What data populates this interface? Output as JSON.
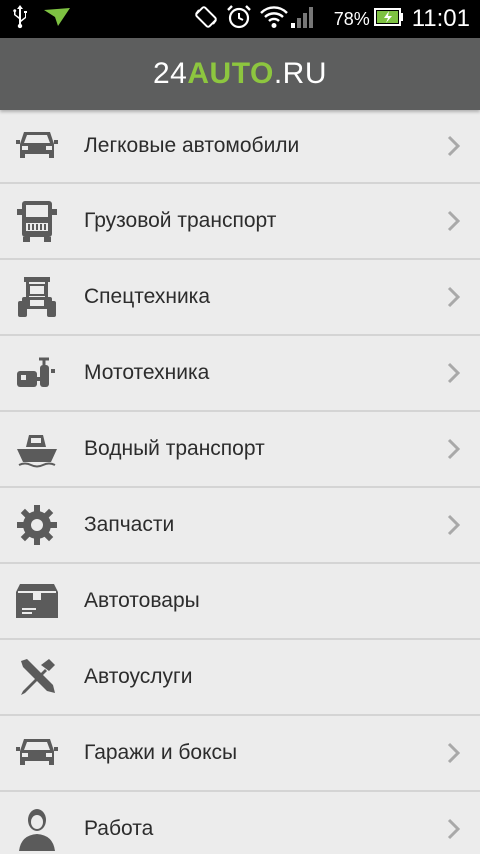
{
  "status_bar": {
    "battery_percent": "78%",
    "time": "11:01",
    "icons": [
      "usb-icon",
      "notification-arrow-icon",
      "rotation-icon",
      "alarm-icon",
      "wifi-icon",
      "signal-icon",
      "battery-charging-icon"
    ]
  },
  "app_bar": {
    "logo_part1": "24",
    "logo_part2": "AUTO",
    "logo_part3": ".RU",
    "accent_color": "#8dc63f",
    "bar_color": "#5d5e5e"
  },
  "menu": {
    "items": [
      {
        "label": "Легковые автомобили",
        "icon": "car-icon",
        "has_chevron": true
      },
      {
        "label": "Грузовой транспорт",
        "icon": "truck-icon",
        "has_chevron": true
      },
      {
        "label": "Спецтехника",
        "icon": "special-vehicle-icon",
        "has_chevron": true
      },
      {
        "label": "Мототехника",
        "icon": "motorcycle-icon",
        "has_chevron": true
      },
      {
        "label": "Водный транспорт",
        "icon": "boat-icon",
        "has_chevron": true
      },
      {
        "label": "Запчасти",
        "icon": "gear-icon",
        "has_chevron": true
      },
      {
        "label": "Автотовары",
        "icon": "box-icon",
        "has_chevron": false
      },
      {
        "label": "Автоуслуги",
        "icon": "tools-icon",
        "has_chevron": false
      },
      {
        "label": "Гаражи и боксы",
        "icon": "garage-car-icon",
        "has_chevron": true
      },
      {
        "label": "Работа",
        "icon": "person-icon",
        "has_chevron": true
      }
    ]
  }
}
